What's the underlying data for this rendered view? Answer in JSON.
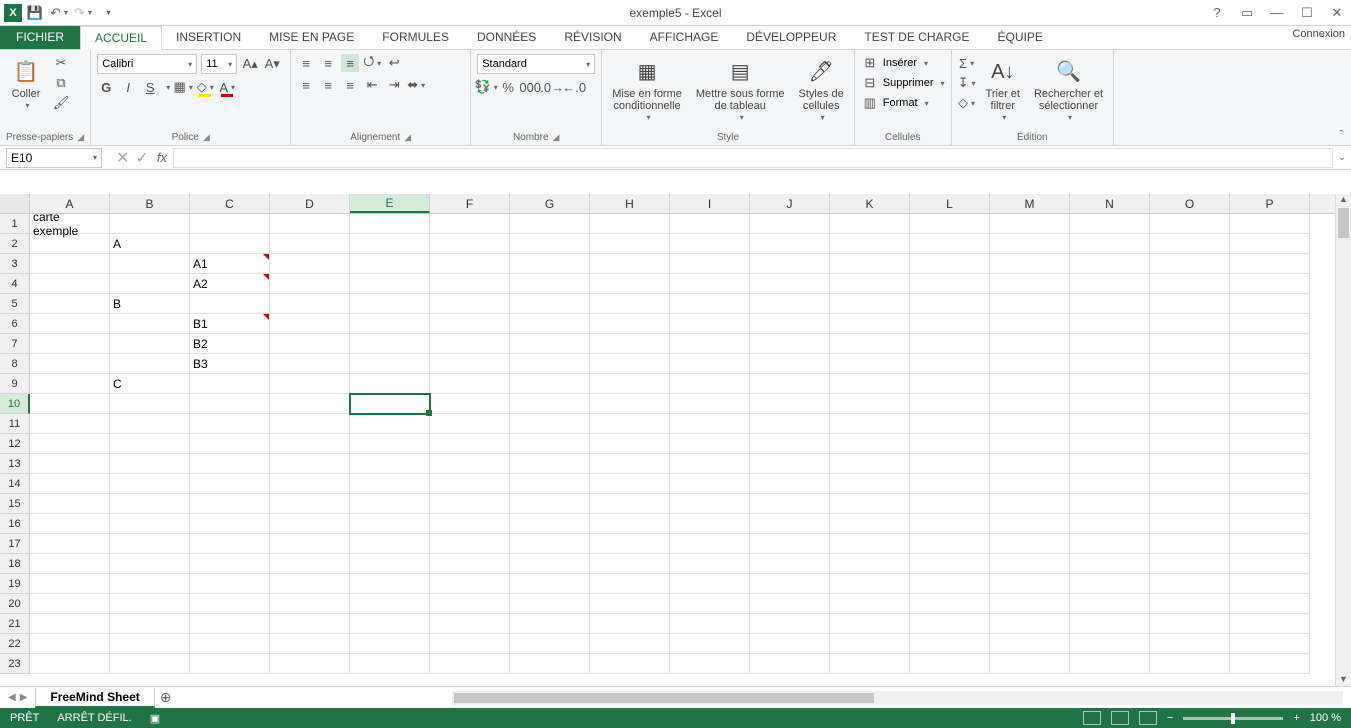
{
  "title": "exemple5 - Excel",
  "connexion": "Connexion",
  "tabs": {
    "file": "FICHIER",
    "items": [
      "ACCUEIL",
      "INSERTION",
      "MISE EN PAGE",
      "FORMULES",
      "DONNÉES",
      "RÉVISION",
      "AFFICHAGE",
      "DÉVELOPPEUR",
      "TEST DE CHARGE",
      "ÉQUIPE"
    ],
    "active": 0
  },
  "ribbon": {
    "clipboard": {
      "paste": "Coller",
      "label": "Presse-papiers"
    },
    "font": {
      "name": "Calibri",
      "size": "11",
      "label": "Police",
      "bold": "G",
      "italic": "I",
      "underline": "S"
    },
    "alignment": {
      "label": "Alignement"
    },
    "number": {
      "format": "Standard",
      "label": "Nombre"
    },
    "styles": {
      "cond": "Mise en forme\nconditionnelle",
      "table": "Mettre sous forme\nde tableau",
      "cell": "Styles de\ncellules",
      "label": "Style"
    },
    "cells": {
      "insert": "Insérer",
      "delete": "Supprimer",
      "format": "Format",
      "label": "Cellules"
    },
    "editing": {
      "sort": "Trier et\nfiltrer",
      "find": "Rechercher et\nsélectionner",
      "label": "Édition"
    }
  },
  "namebox": "E10",
  "columns": [
    "A",
    "B",
    "C",
    "D",
    "E",
    "F",
    "G",
    "H",
    "I",
    "J",
    "K",
    "L",
    "M",
    "N",
    "O",
    "P"
  ],
  "selected": {
    "col": "E",
    "row": 10
  },
  "rowCount": 23,
  "cells": {
    "A1": "carte exemple",
    "B2": "A",
    "C3": "A1",
    "C4": "A2",
    "B5": "B",
    "C6": "B1",
    "C7": "B2",
    "C8": "B3",
    "B9": "C"
  },
  "comments": [
    "C3",
    "C4",
    "C6"
  ],
  "sheet": {
    "name": "FreeMind Sheet"
  },
  "status": {
    "ready": "PRÊT",
    "scroll": "ARRÊT DÉFIL.",
    "zoom": "100 %"
  }
}
